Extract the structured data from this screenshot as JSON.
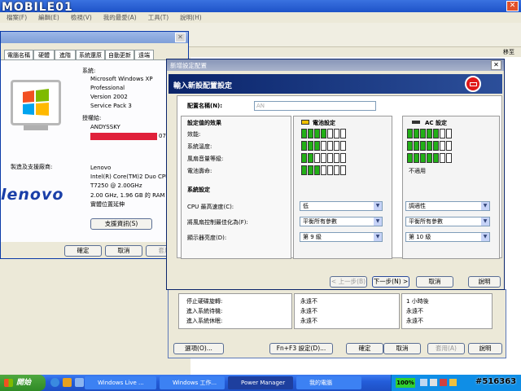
{
  "watermark": {
    "brand": "MOBILE01",
    "id": "#516363"
  },
  "explorer": {
    "menu": [
      "檔案(F)",
      "編輯(E)",
      "檢視(V)",
      "我的最愛(A)",
      "工具(T)",
      "說明(H)"
    ],
    "right_label": "移至"
  },
  "sysprops": {
    "tabs": [
      "電腦名稱",
      "硬體",
      "進階",
      "系統還原",
      "自動更新",
      "遠端"
    ],
    "system_label": "系統:",
    "system_lines": [
      "Microsoft Windows XP",
      "Professional",
      "Version 2002",
      "Service Pack 3"
    ],
    "registered_label": "授權給:",
    "registered_name": "ANDYSSKY",
    "registered_suffix": "07",
    "maker_label": "製造及支援廠商:",
    "maker_lines": [
      "Lenovo",
      "Intel(R) Core(TM)2 Duo CPU",
      "  T7250  @ 2.00GHz",
      "2.00 GHz, 1.96 GB 的 RAM",
      "實體位置延伸"
    ],
    "logo_text": "lenovo",
    "support_button": "支援資訊(S)",
    "ok": "確定",
    "cancel": "取消",
    "apply": "套用"
  },
  "back_dialog": {
    "rows": [
      "停止硬碟旋轉:",
      "進入系統待機:",
      "進入系統休眠:"
    ],
    "battery_values": [
      "永遠不",
      "永遠不",
      "永遠不"
    ],
    "ac_values": [
      "1 小時後",
      "永遠不",
      "永遠不"
    ],
    "buttons": [
      "選項(O)...",
      "Fn+F3 設定(D)...",
      "確定",
      "取消",
      "套用(A)",
      "說明"
    ]
  },
  "dialog": {
    "title": "新增設定配置",
    "header": "輸入新設配置設定",
    "name_label": "配置名稱(N):",
    "name_value": "AN",
    "effect_label": "設定值的效果",
    "battery_header": "電池設定",
    "ac_header": "AC 設定",
    "effect_rows": [
      {
        "label": "效能:",
        "battery": 4,
        "ac": 5
      },
      {
        "label": "系統溫度:",
        "battery": 3,
        "ac": 5
      },
      {
        "label": "風扇音量等級:",
        "battery": 2,
        "ac": 5
      },
      {
        "label": "電池壽命:",
        "battery": 3,
        "ac_text": "不適用"
      }
    ],
    "bar_total": 7,
    "system_label": "系統設定",
    "system_rows": [
      {
        "label": "CPU 最高速度(C):",
        "battery": "低",
        "ac": "調適性"
      },
      {
        "label": "將風扇控制最佳化為(F):",
        "battery": "平衡所有參數",
        "ac": "平衡所有參數"
      },
      {
        "label": "顯示器亮度(D):",
        "battery": "第 9 級",
        "ac": "第 10 級"
      }
    ],
    "buttons": {
      "back": "< 上一步(B)",
      "next": "下一步(N) >",
      "cancel": "取消",
      "help": "說明"
    }
  },
  "taskbar": {
    "start": "開始",
    "tasks": [
      "Windows Live ...",
      "Windows 工作...",
      "Power Manager",
      "我的電腦"
    ],
    "battery": "100%"
  },
  "colors": {
    "dialog_title": "#0a246a",
    "bar_on": "#22b016",
    "taskbar": "#245edb",
    "start": "#3c8d2f"
  }
}
